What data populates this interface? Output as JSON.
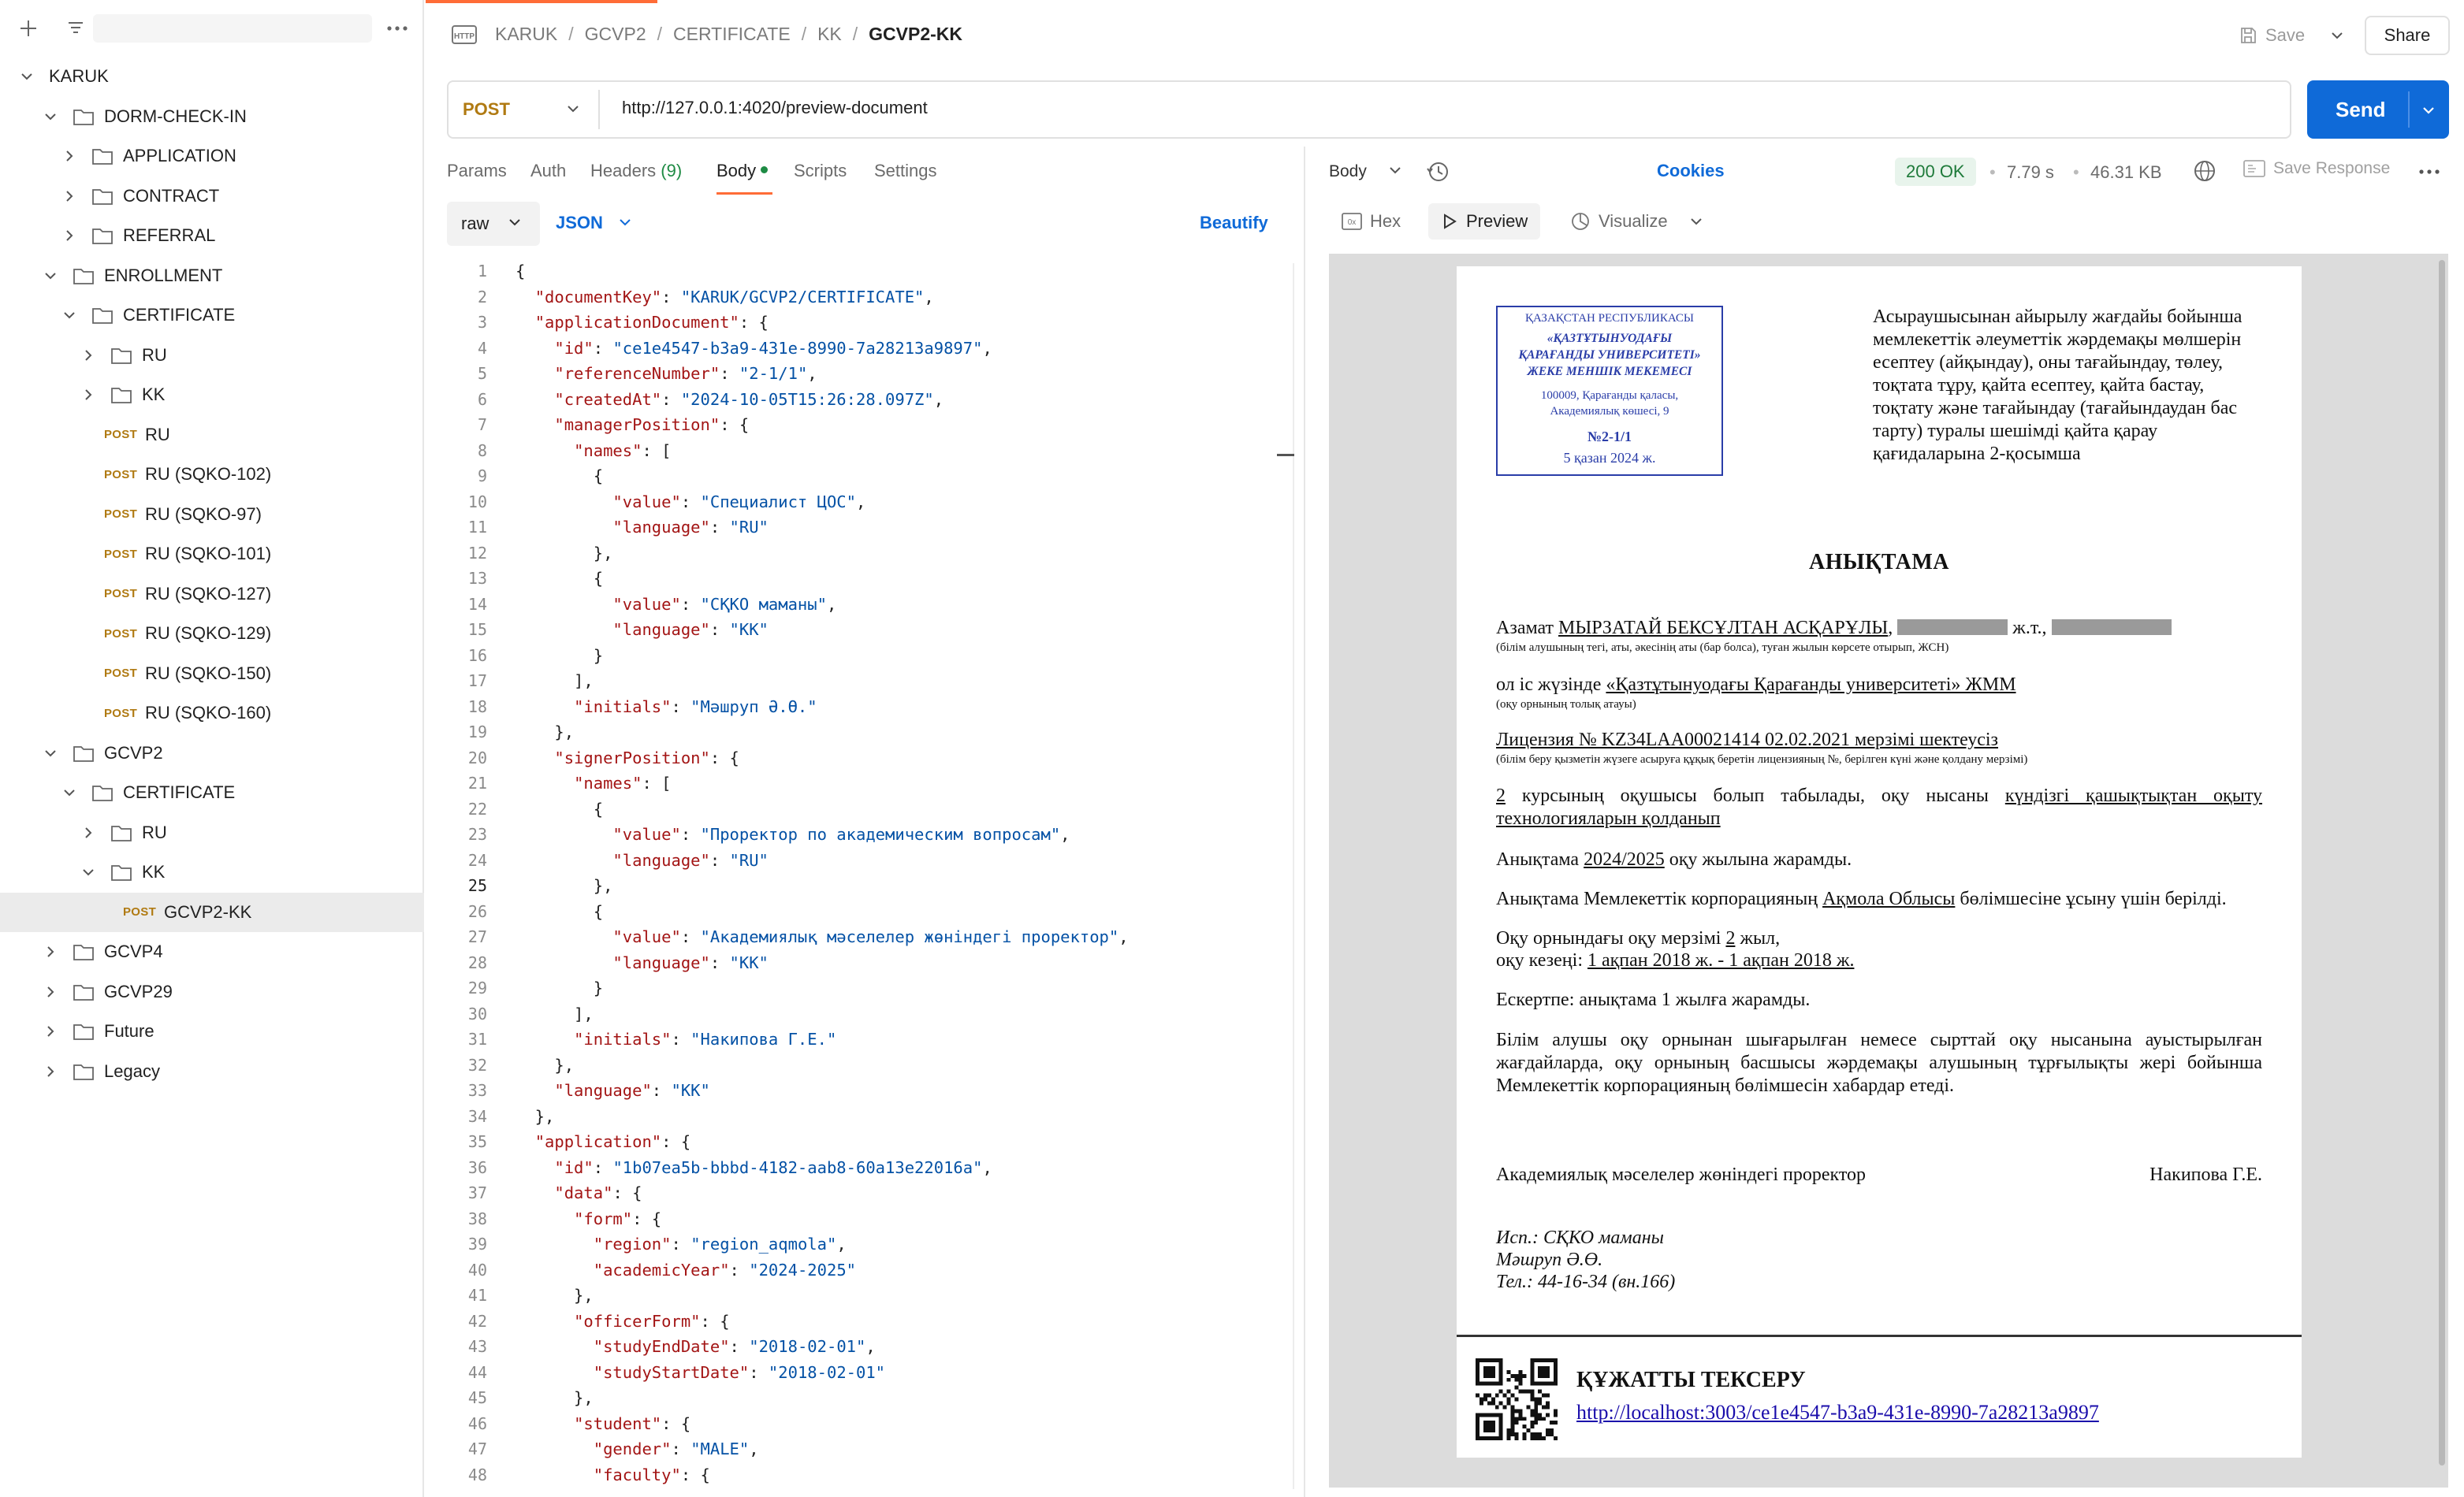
{
  "sidebar": {
    "tree": [
      {
        "label": "KARUK",
        "type": "folder-root",
        "depth": 0,
        "state": "open"
      },
      {
        "label": "DORM-CHECK-IN",
        "type": "folder",
        "depth": 1,
        "state": "open"
      },
      {
        "label": "APPLICATION",
        "type": "folder",
        "depth": 2,
        "state": "closed"
      },
      {
        "label": "CONTRACT",
        "type": "folder",
        "depth": 2,
        "state": "closed"
      },
      {
        "label": "REFERRAL",
        "type": "folder",
        "depth": 2,
        "state": "closed"
      },
      {
        "label": "ENROLLMENT",
        "type": "folder",
        "depth": 1,
        "state": "open"
      },
      {
        "label": "CERTIFICATE",
        "type": "folder",
        "depth": 2,
        "state": "open"
      },
      {
        "label": "RU",
        "type": "folder",
        "depth": 3,
        "state": "closed"
      },
      {
        "label": "KK",
        "type": "folder",
        "depth": 3,
        "state": "closed"
      },
      {
        "label": "RU",
        "type": "request",
        "method": "POST",
        "depth": 3
      },
      {
        "label": "RU (SQKO-102)",
        "type": "request",
        "method": "POST",
        "depth": 3
      },
      {
        "label": "RU (SQKO-97)",
        "type": "request",
        "method": "POST",
        "depth": 3
      },
      {
        "label": "RU (SQKO-101)",
        "type": "request",
        "method": "POST",
        "depth": 3
      },
      {
        "label": "RU (SQKO-127)",
        "type": "request",
        "method": "POST",
        "depth": 3
      },
      {
        "label": "RU (SQKO-129)",
        "type": "request",
        "method": "POST",
        "depth": 3
      },
      {
        "label": "RU (SQKO-150)",
        "type": "request",
        "method": "POST",
        "depth": 3
      },
      {
        "label": "RU (SQKO-160)",
        "type": "request",
        "method": "POST",
        "depth": 3
      },
      {
        "label": "GCVP2",
        "type": "folder",
        "depth": 1,
        "state": "open"
      },
      {
        "label": "CERTIFICATE",
        "type": "folder",
        "depth": 2,
        "state": "open"
      },
      {
        "label": "RU",
        "type": "folder",
        "depth": 3,
        "state": "closed"
      },
      {
        "label": "KK",
        "type": "folder",
        "depth": 3,
        "state": "open"
      },
      {
        "label": "GCVP2-KK",
        "type": "request",
        "method": "POST",
        "depth": 4,
        "selected": true
      },
      {
        "label": "GCVP4",
        "type": "folder",
        "depth": 1,
        "state": "closed"
      },
      {
        "label": "GCVP29",
        "type": "folder",
        "depth": 1,
        "state": "closed"
      },
      {
        "label": "Future",
        "type": "folder",
        "depth": 1,
        "state": "closed"
      },
      {
        "label": "Legacy",
        "type": "folder",
        "depth": 1,
        "state": "closed"
      }
    ]
  },
  "header": {
    "breadcrumb": [
      "KARUK",
      "GCVP2",
      "CERTIFICATE",
      "KK"
    ],
    "current": "GCVP2-KK",
    "save_label": "Save",
    "share_label": "Share"
  },
  "request": {
    "method": "POST",
    "url": "http://127.0.0.1:4020/preview-document",
    "send_label": "Send",
    "tabs": {
      "params": "Params",
      "auth": "Auth",
      "headers": "Headers",
      "headers_count": "(9)",
      "body": "Body",
      "scripts": "Scripts",
      "settings": "Settings",
      "cookies": "Cookies"
    },
    "body_mode": "raw",
    "body_lang": "JSON",
    "beautify": "Beautify"
  },
  "editor": {
    "lines": [
      [
        [
          "p",
          "{"
        ]
      ],
      [
        [
          "p",
          "  "
        ],
        [
          "k",
          "\"documentKey\""
        ],
        [
          "p",
          ": "
        ],
        [
          "s",
          "\"KARUK/GCVP2/CERTIFICATE\""
        ],
        [
          "p",
          ","
        ]
      ],
      [
        [
          "p",
          "  "
        ],
        [
          "k",
          "\"applicationDocument\""
        ],
        [
          "p",
          ": {"
        ]
      ],
      [
        [
          "p",
          "    "
        ],
        [
          "k",
          "\"id\""
        ],
        [
          "p",
          ": "
        ],
        [
          "s",
          "\"ce1e4547-b3a9-431e-8990-7a28213a9897\""
        ],
        [
          "p",
          ","
        ]
      ],
      [
        [
          "p",
          "    "
        ],
        [
          "k",
          "\"referenceNumber\""
        ],
        [
          "p",
          ": "
        ],
        [
          "s",
          "\"2-1/1\""
        ],
        [
          "p",
          ","
        ]
      ],
      [
        [
          "p",
          "    "
        ],
        [
          "k",
          "\"createdAt\""
        ],
        [
          "p",
          ": "
        ],
        [
          "s",
          "\"2024-10-05T15:26:28.097Z\""
        ],
        [
          "p",
          ","
        ]
      ],
      [
        [
          "p",
          "    "
        ],
        [
          "k",
          "\"managerPosition\""
        ],
        [
          "p",
          ": {"
        ]
      ],
      [
        [
          "p",
          "      "
        ],
        [
          "k",
          "\"names\""
        ],
        [
          "p",
          ": ["
        ]
      ],
      [
        [
          "p",
          "        {"
        ]
      ],
      [
        [
          "p",
          "          "
        ],
        [
          "k",
          "\"value\""
        ],
        [
          "p",
          ": "
        ],
        [
          "s",
          "\"Специалист ЦОС\""
        ],
        [
          "p",
          ","
        ]
      ],
      [
        [
          "p",
          "          "
        ],
        [
          "k",
          "\"language\""
        ],
        [
          "p",
          ": "
        ],
        [
          "s",
          "\"RU\""
        ]
      ],
      [
        [
          "p",
          "        },"
        ]
      ],
      [
        [
          "p",
          "        {"
        ]
      ],
      [
        [
          "p",
          "          "
        ],
        [
          "k",
          "\"value\""
        ],
        [
          "p",
          ": "
        ],
        [
          "s",
          "\"СҚКО маманы\""
        ],
        [
          "p",
          ","
        ]
      ],
      [
        [
          "p",
          "          "
        ],
        [
          "k",
          "\"language\""
        ],
        [
          "p",
          ": "
        ],
        [
          "s",
          "\"KK\""
        ]
      ],
      [
        [
          "p",
          "        }"
        ]
      ],
      [
        [
          "p",
          "      ],"
        ]
      ],
      [
        [
          "p",
          "      "
        ],
        [
          "k",
          "\"initials\""
        ],
        [
          "p",
          ": "
        ],
        [
          "s",
          "\"Мәшруп Ә.Ө.\""
        ]
      ],
      [
        [
          "p",
          "    },"
        ]
      ],
      [
        [
          "p",
          "    "
        ],
        [
          "k",
          "\"signerPosition\""
        ],
        [
          "p",
          ": {"
        ]
      ],
      [
        [
          "p",
          "      "
        ],
        [
          "k",
          "\"names\""
        ],
        [
          "p",
          ": ["
        ]
      ],
      [
        [
          "p",
          "        {"
        ]
      ],
      [
        [
          "p",
          "          "
        ],
        [
          "k",
          "\"value\""
        ],
        [
          "p",
          ": "
        ],
        [
          "s",
          "\"Проректор по академическим вопросам\""
        ],
        [
          "p",
          ","
        ]
      ],
      [
        [
          "p",
          "          "
        ],
        [
          "k",
          "\"language\""
        ],
        [
          "p",
          ": "
        ],
        [
          "s",
          "\"RU\""
        ]
      ],
      [
        [
          "p",
          "        },"
        ]
      ],
      [
        [
          "p",
          "        {"
        ]
      ],
      [
        [
          "p",
          "          "
        ],
        [
          "k",
          "\"value\""
        ],
        [
          "p",
          ": "
        ],
        [
          "s",
          "\"Академиялық мәселелер жөніндегі проректор\""
        ],
        [
          "p",
          ","
        ]
      ],
      [
        [
          "p",
          "          "
        ],
        [
          "k",
          "\"language\""
        ],
        [
          "p",
          ": "
        ],
        [
          "s",
          "\"KK\""
        ]
      ],
      [
        [
          "p",
          "        }"
        ]
      ],
      [
        [
          "p",
          "      ],"
        ]
      ],
      [
        [
          "p",
          "      "
        ],
        [
          "k",
          "\"initials\""
        ],
        [
          "p",
          ": "
        ],
        [
          "s",
          "\"Накипова Г.Е.\""
        ]
      ],
      [
        [
          "p",
          "    },"
        ]
      ],
      [
        [
          "p",
          "    "
        ],
        [
          "k",
          "\"language\""
        ],
        [
          "p",
          ": "
        ],
        [
          "s",
          "\"KK\""
        ]
      ],
      [
        [
          "p",
          "  },"
        ]
      ],
      [
        [
          "p",
          "  "
        ],
        [
          "k",
          "\"application\""
        ],
        [
          "p",
          ": {"
        ]
      ],
      [
        [
          "p",
          "    "
        ],
        [
          "k",
          "\"id\""
        ],
        [
          "p",
          ": "
        ],
        [
          "s",
          "\"1b07ea5b-bbbd-4182-aab8-60a13e22016a\""
        ],
        [
          "p",
          ","
        ]
      ],
      [
        [
          "p",
          "    "
        ],
        [
          "k",
          "\"data\""
        ],
        [
          "p",
          ": {"
        ]
      ],
      [
        [
          "p",
          "      "
        ],
        [
          "k",
          "\"form\""
        ],
        [
          "p",
          ": {"
        ]
      ],
      [
        [
          "p",
          "        "
        ],
        [
          "k",
          "\"region\""
        ],
        [
          "p",
          ": "
        ],
        [
          "s",
          "\"region_aqmola\""
        ],
        [
          "p",
          ","
        ]
      ],
      [
        [
          "p",
          "        "
        ],
        [
          "k",
          "\"academicYear\""
        ],
        [
          "p",
          ": "
        ],
        [
          "s",
          "\"2024-2025\""
        ]
      ],
      [
        [
          "p",
          "      },"
        ]
      ],
      [
        [
          "p",
          "      "
        ],
        [
          "k",
          "\"officerForm\""
        ],
        [
          "p",
          ": {"
        ]
      ],
      [
        [
          "p",
          "        "
        ],
        [
          "k",
          "\"studyEndDate\""
        ],
        [
          "p",
          ": "
        ],
        [
          "s",
          "\"2018-02-01\""
        ],
        [
          "p",
          ","
        ]
      ],
      [
        [
          "p",
          "        "
        ],
        [
          "k",
          "\"studyStartDate\""
        ],
        [
          "p",
          ": "
        ],
        [
          "s",
          "\"2018-02-01\""
        ]
      ],
      [
        [
          "p",
          "      },"
        ]
      ],
      [
        [
          "p",
          "      "
        ],
        [
          "k",
          "\"student\""
        ],
        [
          "p",
          ": {"
        ]
      ],
      [
        [
          "p",
          "        "
        ],
        [
          "k",
          "\"gender\""
        ],
        [
          "p",
          ": "
        ],
        [
          "s",
          "\"MALE\""
        ],
        [
          "p",
          ","
        ]
      ],
      [
        [
          "p",
          "        "
        ],
        [
          "k",
          "\"faculty\""
        ],
        [
          "p",
          ": {"
        ]
      ]
    ]
  },
  "response": {
    "body_label": "Body",
    "status": "200 OK",
    "time": "7.79 s",
    "size": "46.31 KB",
    "save_response": "Save Response",
    "views": {
      "hex": "Hex",
      "preview": "Preview",
      "visualize": "Visualize"
    }
  },
  "document": {
    "stamp": {
      "line1": "ҚАЗАҚСТАН РЕСПУБЛИКАСЫ",
      "line2": "«ҚАЗТҰТЫНУОДАҒЫ",
      "line3": "ҚАРАҒАНДЫ УНИВЕРСИТЕТІ»",
      "line4": "ЖЕКЕ МЕНШІК МЕКЕМЕСІ",
      "line5": "100009, Қарағанды қаласы,",
      "line6": "Академиялық көшесі, 9",
      "number": "№2-1/1",
      "date": "5 қазан 2024 ж."
    },
    "appendix": "Асыраушысынан айырылу жағдайы бойынша мемлекеттік әлеуметтік жәрдемақы мөлшерін есептеу (айқындау), оны тағайындау, төлеу, тоқтата тұру, қайта есептеу, қайта бастау, тоқтату және тағайындау (тағайындаудан бас тарту) туралы шешімді қайта қарау қағидаларына 2-қосымша",
    "title": "АНЫҚТАМА",
    "citizen_prefix": "Азамат",
    "citizen_name": "МЫРЗАТАЙ БЕКСҰЛТАН АСҚАРҰЛЫ",
    "birth_suffix": "ж.т.,",
    "citizen_note": "(білім алушының тегі, аты, әкесінің аты (бар болса), туған жылын көрсете отырып, ЖСН)",
    "org_prefix": "ол іс жүзінде",
    "org_name": "«Қазтұтынуодағы Қарағанды университеті» ЖММ",
    "org_note": "(оқу орнының толық атауы)",
    "license": "Лицензия № KZ34LAA00021414 02.02.2021 мерзімі шектеусіз",
    "license_note": "(білім беру қызметін жүзеге асыруға құқық беретін лицензияның №, берілген күні және қолдану мерзімі)",
    "course_num": "2",
    "course_text": "курсының оқушысы болып табылады, оқу нысаны",
    "course_form": "күндізгі қашықтықтан оқыту технологияларын қолданып",
    "valid_prefix": "Анықтама",
    "valid_year": "2024/2025",
    "valid_suffix": "оқу жылына жарамды.",
    "given_prefix": "Анықтама Мемлекеттік корпорацияның",
    "given_region": "Ақмола Облысы",
    "given_suffix": "бөлімшесіне ұсыну үшін берілді.",
    "term_prefix": "Оқу орнындағы оқу мерзімі",
    "term_years": "2",
    "term_suffix": "жыл,",
    "period_prefix": "оқу кезеңі:",
    "period": "1 ақпан 2018 ж. - 1 ақпан 2018 ж.",
    "note": "Ескертпе: анықтама 1 жылға жарамды.",
    "warning": "Білім алушы оқу орнынан шығарылған немесе сырттай оқу нысанына ауыстырылған жағдайларда, оқу орнының басшысы жәрдемақы алушының тұрғылықты жері бойынша Мемлекеттік корпорацияның бөлімшесін хабардар етеді.",
    "signer_position": "Академиялық мәселелер жөніндегі проректор",
    "signer_name": "Накипова Г.Е.",
    "exec1": "Исп.: СҚКО маманы",
    "exec2": "Мәшруп Ә.Ө.",
    "exec3": "Тел.: 44-16-34 (вн.166)",
    "verify_title": "ҚҰЖАТТЫ ТЕКСЕРУ",
    "verify_link": "http://localhost:3003/ce1e4547-b3a9-431e-8990-7a28213a9897"
  },
  "colors": {
    "accent": "#ff6c37",
    "send": "#0f6ad8",
    "post": "#b07a12",
    "status_ok": "#1e7a3a",
    "json_key": "#a31515",
    "json_string": "#0451a5",
    "stamp": "#2a3da8"
  }
}
